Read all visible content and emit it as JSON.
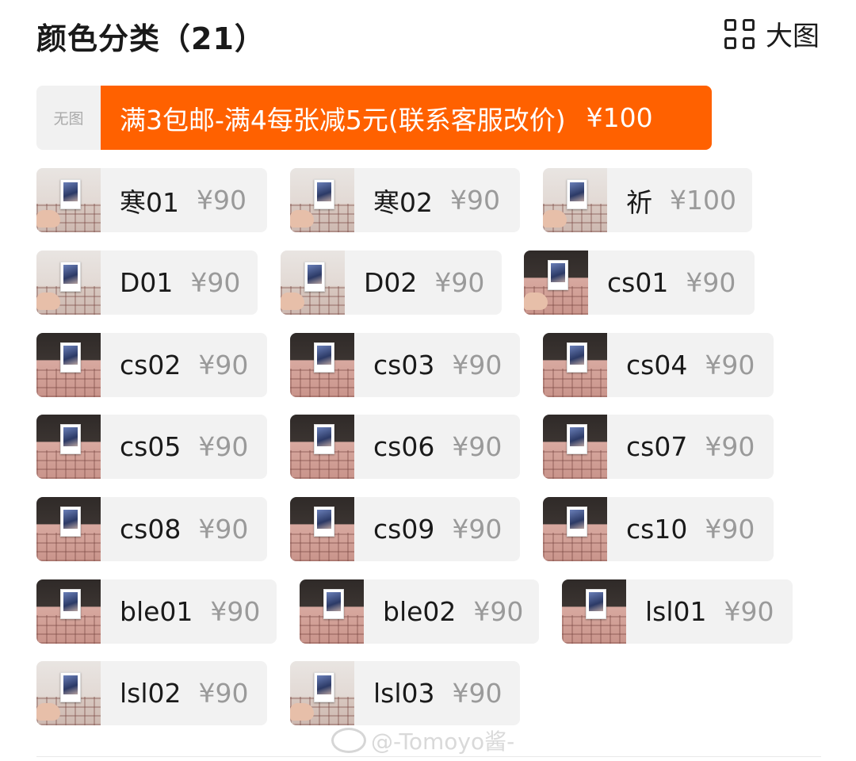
{
  "header": {
    "title": "颜色分类（21）",
    "view_label": "大图"
  },
  "promo": {
    "thumb_text": "无图",
    "label": "满3包邮-满4每张减5元(联系客服改价)",
    "price": "¥100",
    "accent_color": "#ff6100"
  },
  "variants": [
    {
      "name": "寒01",
      "price": "¥90"
    },
    {
      "name": "寒02",
      "price": "¥90"
    },
    {
      "name": "祈",
      "price": "¥100"
    },
    {
      "name": "D01",
      "price": "¥90"
    },
    {
      "name": "D02",
      "price": "¥90"
    },
    {
      "name": "cs01",
      "price": "¥90"
    },
    {
      "name": "cs02",
      "price": "¥90"
    },
    {
      "name": "cs03",
      "price": "¥90"
    },
    {
      "name": "cs04",
      "price": "¥90"
    },
    {
      "name": "cs05",
      "price": "¥90"
    },
    {
      "name": "cs06",
      "price": "¥90"
    },
    {
      "name": "cs07",
      "price": "¥90"
    },
    {
      "name": "cs08",
      "price": "¥90"
    },
    {
      "name": "cs09",
      "price": "¥90"
    },
    {
      "name": "cs10",
      "price": "¥90"
    },
    {
      "name": "ble01",
      "price": "¥90"
    },
    {
      "name": "ble02",
      "price": "¥90"
    },
    {
      "name": "lsl01",
      "price": "¥90"
    },
    {
      "name": "lsl02",
      "price": "¥90"
    },
    {
      "name": "lsl03",
      "price": "¥90"
    }
  ],
  "watermark": "@-Tomoyo酱-"
}
